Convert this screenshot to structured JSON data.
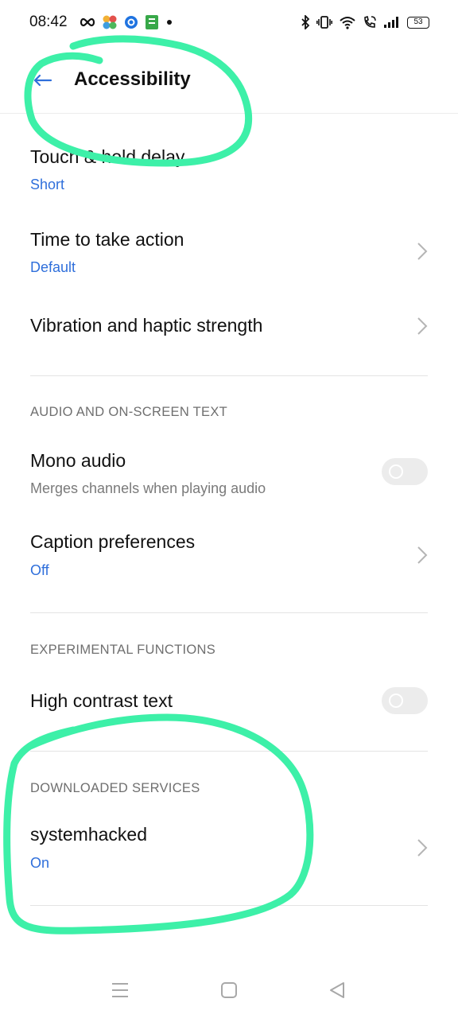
{
  "status_bar": {
    "time": "08:42",
    "battery": "53"
  },
  "header": {
    "title": "Accessibility"
  },
  "items": [
    {
      "title": "Touch & hold delay",
      "subtitle": "Short"
    },
    {
      "title": "Time to take action",
      "subtitle": "Default"
    },
    {
      "title": "Vibration and haptic strength"
    }
  ],
  "sections": {
    "audio": {
      "label": "AUDIO AND ON-SCREEN TEXT",
      "mono_audio": {
        "title": "Mono audio",
        "subtitle": "Merges channels when playing audio",
        "enabled": false
      },
      "captions": {
        "title": "Caption preferences",
        "subtitle": "Off"
      }
    },
    "experimental": {
      "label": "EXPERIMENTAL FUNCTIONS",
      "high_contrast": {
        "title": "High contrast text",
        "enabled": false
      }
    },
    "downloaded": {
      "label": "DOWNLOADED SERVICES",
      "service": {
        "title": "systemhacked",
        "subtitle": "On"
      }
    }
  },
  "colors": {
    "accent_blue": "#2f6fdb",
    "annotation_green": "#3df0a8"
  },
  "icons": [
    "infinity-icon",
    "pinwheel-app-icon",
    "blue-circle-app-icon",
    "green-app-icon",
    "bluetooth-icon",
    "vibrate-icon",
    "wifi-icon",
    "wifi-calling-icon",
    "signal-icon",
    "battery-icon",
    "back-arrow-icon",
    "chevron-right-icon",
    "menu-nav-icon",
    "home-nav-icon",
    "back-nav-icon"
  ]
}
